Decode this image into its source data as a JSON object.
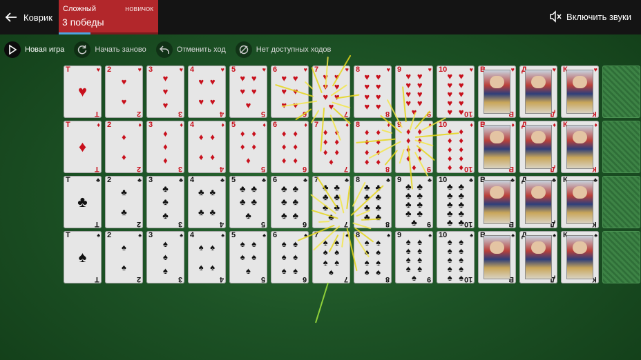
{
  "header": {
    "back_label": "Коврик",
    "mode_name": "Сложный",
    "mode_level": "новичок",
    "wins": "3 победы",
    "progress": 0.32,
    "progress_color": "#4da3e0",
    "sound_label": "Включить звуки"
  },
  "toolbar": {
    "buttons": [
      {
        "label": "Новая игра",
        "icon": "play-icon",
        "active": true
      },
      {
        "label": "Начать заново",
        "icon": "restart-icon",
        "active": false
      },
      {
        "label": "Отменить ход",
        "icon": "undo-icon",
        "active": false
      },
      {
        "label": "Нет доступных ходов",
        "icon": "no-hint-icon",
        "active": false
      }
    ]
  },
  "colors": {
    "red_suit": "#c8101c",
    "black_suit": "#111111",
    "table_green": "#1d5326",
    "mode_red": "#b2272b"
  },
  "board": {
    "ranks": [
      "Т",
      "2",
      "3",
      "4",
      "5",
      "6",
      "7",
      "8",
      "9",
      "10",
      "В",
      "Д",
      "К"
    ],
    "rows": [
      {
        "suit": "♥",
        "color": "red"
      },
      {
        "suit": "♦",
        "color": "red"
      },
      {
        "suit": "♣",
        "color": "black"
      },
      {
        "suit": "♠",
        "color": "black"
      }
    ],
    "empty_slot_per_row": true
  }
}
